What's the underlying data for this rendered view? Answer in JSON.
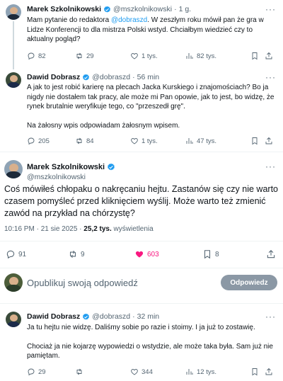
{
  "tweet1": {
    "name": "Marek Szkolnikowski",
    "handle": "@mszkolnikowski",
    "time": "1 g.",
    "text_pre": "Mam pytanie do redaktora ",
    "mention": "@dobraszd",
    "text_post": ". W zeszłym roku mówił pan że gra w Lidze Konferencji to dla mistrza Polski wstyd. Chciałbym wiedzieć czy to aktualny pogląd?",
    "replies": "82",
    "reposts": "29",
    "likes": "1 tys.",
    "views": "82 tys."
  },
  "tweet2": {
    "name": "Dawid Dobrasz",
    "handle": "@dobraszd",
    "time": "56 min",
    "text_p1": "A jak to jest robić karierę na plecach Jacka Kurskiego i znajomościach? Bo ja nigdy nie dostałem tak pracy, ale może mi Pan opowie, jak to jest, bo widzę, że rynek brutalnie weryfikuje tego, co \"przeszedł grę\".",
    "text_p2": "Na żałosny wpis odpowiadam żałosnym wpisem.",
    "replies": "205",
    "reposts": "84",
    "likes": "1 tys.",
    "views": "47 tys."
  },
  "main": {
    "name": "Marek Szkolnikowski",
    "handle": "@mszkolnikowski",
    "text": "Coś mówiłeś chłopaku o nakręcaniu hejtu. Zastanów się czy nie warto czasem pomyśleć przed kliknięciem wyślij. Może warto też zmienić zawód na przykład na chórzystę?",
    "time": "10:16 PM · 21 sie 2025 · ",
    "views_count": "25,2 tys.",
    "views_label": " wyświetlenia",
    "replies": "91",
    "reposts": "9",
    "likes": "603",
    "bookmarks": "8"
  },
  "compose": {
    "placeholder": "Opublikuj swoją odpowiedź",
    "button": "Odpowiedz"
  },
  "tweet3": {
    "name": "Dawid Dobrasz",
    "handle": "@dobraszd",
    "time": "32 min",
    "text_p1": "Ja tu hejtu nie widzę. Daliśmy sobie po razie i stoimy. I ja już to zostawię.",
    "text_p2": "Chociaż ja nie kojarzę wypowiedzi o wstydzie, ale może taka była. Sam już nie pamiętam.",
    "replies": "29",
    "reposts": "",
    "likes": "344",
    "views": "12 tys."
  },
  "colors": {
    "accent": "#1d9bf0",
    "like": "#f91880",
    "muted": "#536471"
  }
}
